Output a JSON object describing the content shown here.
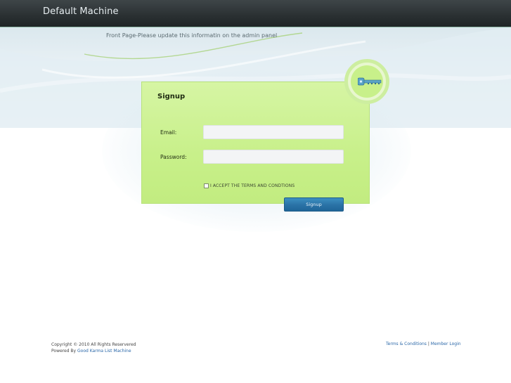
{
  "header": {
    "site_title": "Default Machine"
  },
  "hero": {
    "tagline": "Front Page-Please update this informatin on the admin panel"
  },
  "signup_panel": {
    "title": "Signup",
    "email_label": "Email:",
    "email_value": "",
    "password_label": "Password:",
    "password_value": "",
    "terms_label": "I ACCEPT THE TERMS AND CONDTIONS",
    "terms_checked": false,
    "submit_label": "Signup",
    "key_icon": "key-icon"
  },
  "footer": {
    "copyright": "Copyright © 2010 All Rights Reservered",
    "powered_by_prefix": "Powered By ",
    "powered_by_link": "Good Karma List Machine",
    "terms_link": "Terms & Conditions",
    "separator": " | ",
    "member_login_link": "Member Login"
  },
  "colors": {
    "panel_green": "#c8f08a",
    "button_blue": "#2a72a6",
    "topbar_dark": "#2a3032",
    "link_blue": "#2a67a8"
  }
}
